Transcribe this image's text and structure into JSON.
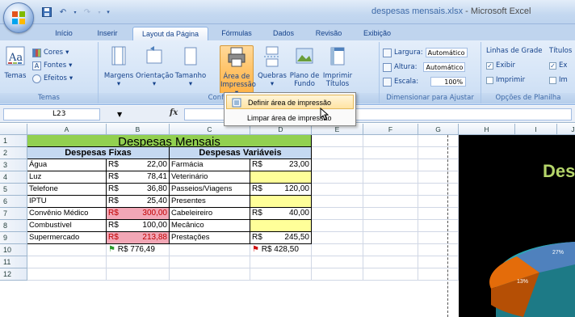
{
  "window": {
    "file_name": "despesas mensais.xlsx",
    "separator": " - ",
    "app_name": "Microsoft Excel"
  },
  "tabs": [
    {
      "label": "Início"
    },
    {
      "label": "Inserir"
    },
    {
      "label": "Layout da Página"
    },
    {
      "label": "Fórmulas"
    },
    {
      "label": "Dados"
    },
    {
      "label": "Revisão"
    },
    {
      "label": "Exibição"
    }
  ],
  "ribbon": {
    "temas": {
      "button": "Temas",
      "cores": "Cores",
      "fontes": "Fontes",
      "efeitos": "Efeitos",
      "label": "Temas"
    },
    "config": {
      "margens": "Margens",
      "orientacao": "Orientação",
      "tamanho": "Tamanho",
      "area_line1": "Área de",
      "area_line2": "Impressão",
      "quebras": "Quebras",
      "plano_line1": "Plano de",
      "plano_line2": "Fundo",
      "imprimir_line1": "Imprimir",
      "imprimir_line2": "Títulos",
      "label": "Configurar Página"
    },
    "dimensionar": {
      "largura": "Largura:",
      "largura_value": "Automático",
      "altura": "Altura:",
      "altura_value": "Automático",
      "escala": "Escala:",
      "escala_value": "100%",
      "label": "Dimensionar para Ajustar"
    },
    "opcoes": {
      "linhas_grade": "Linhas de Grade",
      "titulos": "Títulos",
      "exibir": "Exibir",
      "exibir2": "Ex",
      "imprimir": "Imprimir",
      "imprimir2": "Im",
      "label": "Opções de Planilha"
    }
  },
  "area_menu": {
    "items": [
      {
        "label": "Definir área de impressão"
      },
      {
        "label": "Limpar área de impressão"
      }
    ]
  },
  "formula_bar": {
    "name_box": "L23",
    "fx": "fx",
    "value": ""
  },
  "columns": [
    "A",
    "B",
    "C",
    "D",
    "E",
    "F",
    "G",
    "H",
    "I",
    "J"
  ],
  "rows": [
    "1",
    "2",
    "3",
    "4",
    "5",
    "6",
    "7",
    "8",
    "9",
    "10",
    "11",
    "12"
  ],
  "sheet": {
    "title": "Despesas Mensais",
    "fixed_header": "Despesas Fixas",
    "variable_header": "Despesas Variáveis",
    "currency": "R$",
    "fixed": [
      {
        "name": "Água",
        "value": "22,00"
      },
      {
        "name": "Luz",
        "value": "78,41"
      },
      {
        "name": "Telefone",
        "value": "36,80"
      },
      {
        "name": "IPTU",
        "value": "25,40"
      },
      {
        "name": "Convênio Médico",
        "value": "300,00"
      },
      {
        "name": "Combustível",
        "value": "100,00"
      },
      {
        "name": "Supermercado",
        "value": "213,88"
      }
    ],
    "variable": [
      {
        "name": "Farmácia",
        "currency": "R$",
        "value": "23,00"
      },
      {
        "name": "Veterinário",
        "currency": "",
        "value": ""
      },
      {
        "name": "Passeios/Viagens",
        "currency": "R$",
        "value": "120,00"
      },
      {
        "name": "Presentes",
        "currency": "",
        "value": ""
      },
      {
        "name": "Cabeleireiro",
        "currency": "R$",
        "value": "40,00"
      },
      {
        "name": "Mecânico",
        "currency": "",
        "value": ""
      },
      {
        "name": "Prestações",
        "currency": "R$",
        "value": "245,50"
      }
    ],
    "total_fixed": "R$ 776,49",
    "total_variable": "R$ 428,50"
  },
  "chart": {
    "title_fragment": "Des",
    "labels": [
      "27%",
      "13%"
    ]
  }
}
